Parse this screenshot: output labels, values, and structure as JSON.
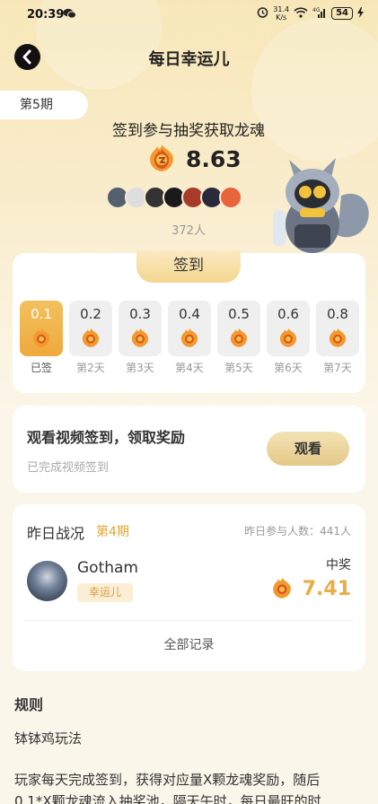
{
  "status_bar": {
    "time": "20:39",
    "speed_value": "31.4",
    "speed_unit": "K/s",
    "network": "4G",
    "battery": "54"
  },
  "header": {
    "title": "每日幸运儿"
  },
  "hero": {
    "period_tag": "第5期",
    "subtitle": "签到参与抽奖获取龙魂",
    "pool_amount": "8.63",
    "participants": "372人"
  },
  "checkin": {
    "tab_label": "签到",
    "days": [
      {
        "value": "0.1",
        "label": "已签",
        "done": true
      },
      {
        "value": "0.2",
        "label": "第2天",
        "done": false
      },
      {
        "value": "0.3",
        "label": "第3天",
        "done": false
      },
      {
        "value": "0.4",
        "label": "第4天",
        "done": false
      },
      {
        "value": "0.5",
        "label": "第5天",
        "done": false
      },
      {
        "value": "0.6",
        "label": "第6天",
        "done": false
      },
      {
        "value": "0.8",
        "label": "第7天",
        "done": false
      }
    ]
  },
  "video_task": {
    "title": "观看视频签到，领取奖励",
    "status": "已完成视频签到",
    "button": "观看"
  },
  "yesterday": {
    "title": "昨日战况",
    "period": "第4期",
    "participants": "昨日参与人数：441人",
    "winner_name": "Gotham",
    "winner_tag": "幸运儿",
    "prize_label": "中奖",
    "prize_amount": "7.41",
    "all_records": "全部记录"
  },
  "rules": {
    "title": "规则",
    "subtitle": "钵钵鸡玩法",
    "line1": "玩家每天完成签到，获得对应量X颗龙魂奖励，随后",
    "line2": "0.1*X颗龙魂流入抽奖池，隔天午时，每日最旺的时"
  },
  "colors": {
    "accent_gold": "#e9ad45",
    "done_day": "#f0a93d",
    "background": "#fbf6ea"
  }
}
